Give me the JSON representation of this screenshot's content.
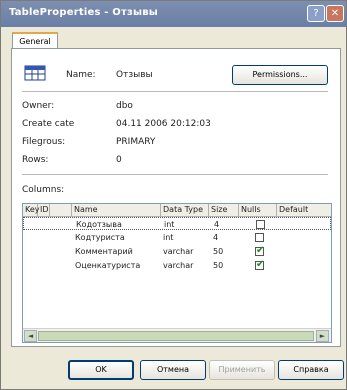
{
  "window": {
    "title": "TableProperties - Отзывы",
    "help_glyph": "?",
    "close_glyph": "✕"
  },
  "tabs": [
    {
      "label": "General"
    }
  ],
  "general": {
    "name_label": "Name:",
    "name_value": "Отзывы",
    "permissions_label": "Permissions...",
    "owner_label": "Owner:",
    "owner_value": "dbo",
    "create_date_label": "Create cate",
    "create_date_value": "04.11 2006 20:12:03",
    "filegroup_label": "Filegrous:",
    "filegroup_value": "PRIMARY",
    "rows_label": "Rows:",
    "rows_value": "0",
    "columns_label": "Columns:"
  },
  "grid": {
    "headers": [
      "Key",
      "ID",
      "Name",
      "Data Type",
      "Size",
      "Nulls",
      "Default"
    ],
    "rows": [
      {
        "name": "Кодотзыва",
        "type": "int",
        "size": "4",
        "nulls": false
      },
      {
        "name": "Кодтуриста",
        "type": "int",
        "size": "4",
        "nulls": false
      },
      {
        "name": "Комментарий",
        "type": "varchar",
        "size": "50",
        "nulls": true
      },
      {
        "name": "Оценкатуриста",
        "type": "varchar",
        "size": "50",
        "nulls": true
      }
    ],
    "scroll_left": "◄",
    "scroll_right": "►"
  },
  "buttons": {
    "ok": "OK",
    "cancel": "Отмена",
    "apply": "Применить",
    "help": "Справка"
  },
  "colors": {
    "titlebar": "#7086ab",
    "check": "#1a8a1a",
    "accent_tab": "#e6a64b"
  }
}
